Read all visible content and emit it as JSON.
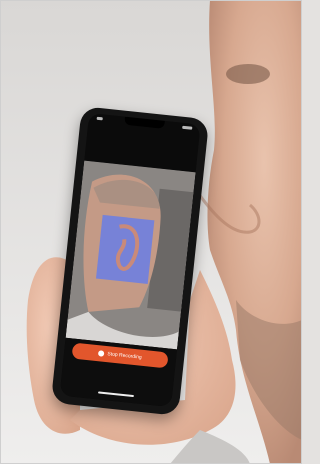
{
  "photo": {
    "phone_app": {
      "stop_recording_label": "Stop Recording"
    }
  },
  "colors": {
    "background_wall": "#e4e2e0",
    "button_accent": "#e2562c",
    "ear_overlay": "#6f7fe0"
  },
  "icons": [
    "record-icon"
  ]
}
